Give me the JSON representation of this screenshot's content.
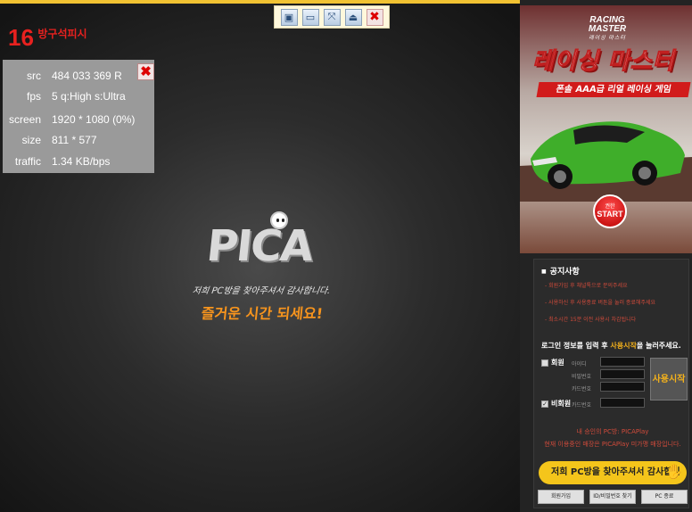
{
  "toolbar": {
    "buttons": [
      {
        "name": "display-button",
        "glyph": "▣"
      },
      {
        "name": "window-button",
        "glyph": "▭"
      },
      {
        "name": "fullscreen-button",
        "glyph": "⤧"
      },
      {
        "name": "eject-button",
        "glyph": "⏏"
      },
      {
        "name": "close-button",
        "glyph": "✖"
      }
    ]
  },
  "counter": {
    "number": "16",
    "label": "방구석피시"
  },
  "stats": [
    {
      "key": "src",
      "value": "484 033 369  R"
    },
    {
      "key": "fps",
      "value": "5 q:High s:Ultra"
    },
    {
      "key": "screen",
      "value": "1920 * 1080 (0%)"
    },
    {
      "key": "size",
      "value": "811 * 577"
    },
    {
      "key": "traffic",
      "value": "1.34 KB/bps"
    }
  ],
  "stats_close_glyph": "✖",
  "logo": {
    "text": "PICA",
    "slogan1": "저희 PC방을 찾아주셔서 감사합니다.",
    "slogan2": "즐거운 시간 되세요!"
  },
  "ad": {
    "brand": "RACING MASTER",
    "brand_sub": "레이싱 마스터",
    "title": "레이싱 마스터",
    "subtitle": "폰솔 AAA급 리얼 레이싱 게임",
    "start_small": "권한",
    "start": "START"
  },
  "notice": {
    "title": "공지사항",
    "items": [
      "회원가입 후 채널톡으로 문의주세요",
      "사용하신 후 사용종료 버튼을 눌러 종료해주세요",
      "최소시간 15분 이전 사용시 차감됩니다"
    ]
  },
  "login": {
    "hint_pre": "로그인 정보를 입력 후 ",
    "hint_hl": "사용시작",
    "hint_post": "을 눌러주세요.",
    "member_label": "회원",
    "id_label": "아이디",
    "pw_label": "비밀번호",
    "card_label": "카드번호",
    "guest_label": "비회원",
    "guest_card_label": "카드번호",
    "start_button": "사용시작"
  },
  "ip_info": {
    "line1": "내 승인의 PC방: PICAPlay",
    "line2": "현재 이용중인 매장은 PICAPlay 미가맹 매장입니다."
  },
  "thanks": "저희 PC방을 찾아주셔서 감사합니다.",
  "bottom": {
    "signup": "회원가입",
    "find": "ID/비밀번호 찾기",
    "pc_end": "PC 종료"
  }
}
